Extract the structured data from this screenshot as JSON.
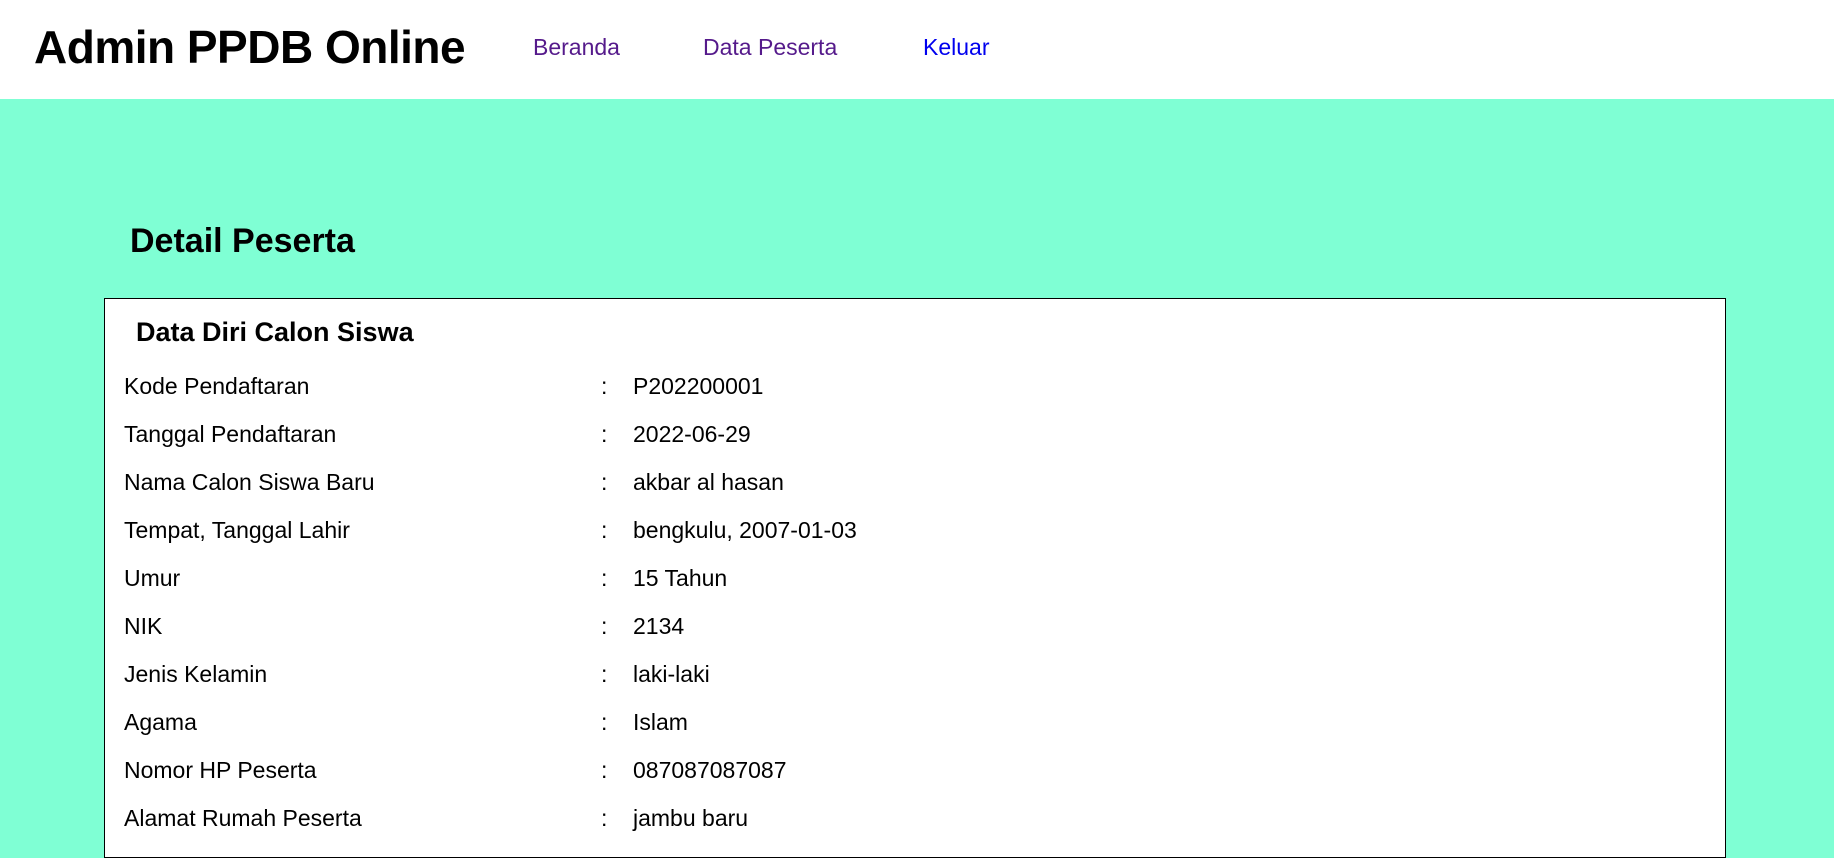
{
  "header": {
    "brand": "Admin PPDB Online",
    "nav": [
      {
        "label": "Beranda"
      },
      {
        "label": "Data Peserta"
      },
      {
        "label": "Keluar"
      }
    ]
  },
  "main": {
    "page_title": "Detail Peserta",
    "section_title": "Data Diri Calon Siswa",
    "separator": ":",
    "rows": [
      {
        "label": "Kode Pendaftaran",
        "value": "P202200001"
      },
      {
        "label": "Tanggal Pendaftaran",
        "value": "2022-06-29"
      },
      {
        "label": "Nama Calon Siswa Baru",
        "value": "akbar al hasan"
      },
      {
        "label": "Tempat, Tanggal Lahir",
        "value": "bengkulu, 2007-01-03"
      },
      {
        "label": "Umur",
        "value": "15 Tahun"
      },
      {
        "label": "NIK",
        "value": "2134"
      },
      {
        "label": "Jenis Kelamin",
        "value": "laki-laki"
      },
      {
        "label": "Agama",
        "value": "Islam"
      },
      {
        "label": "Nomor HP Peserta",
        "value": "087087087087"
      },
      {
        "label": "Alamat Rumah Peserta",
        "value": "jambu baru"
      }
    ]
  },
  "colors": {
    "background": "#7fffd4",
    "link_visited": "#551a8b",
    "link_unvisited": "#0000ee"
  }
}
